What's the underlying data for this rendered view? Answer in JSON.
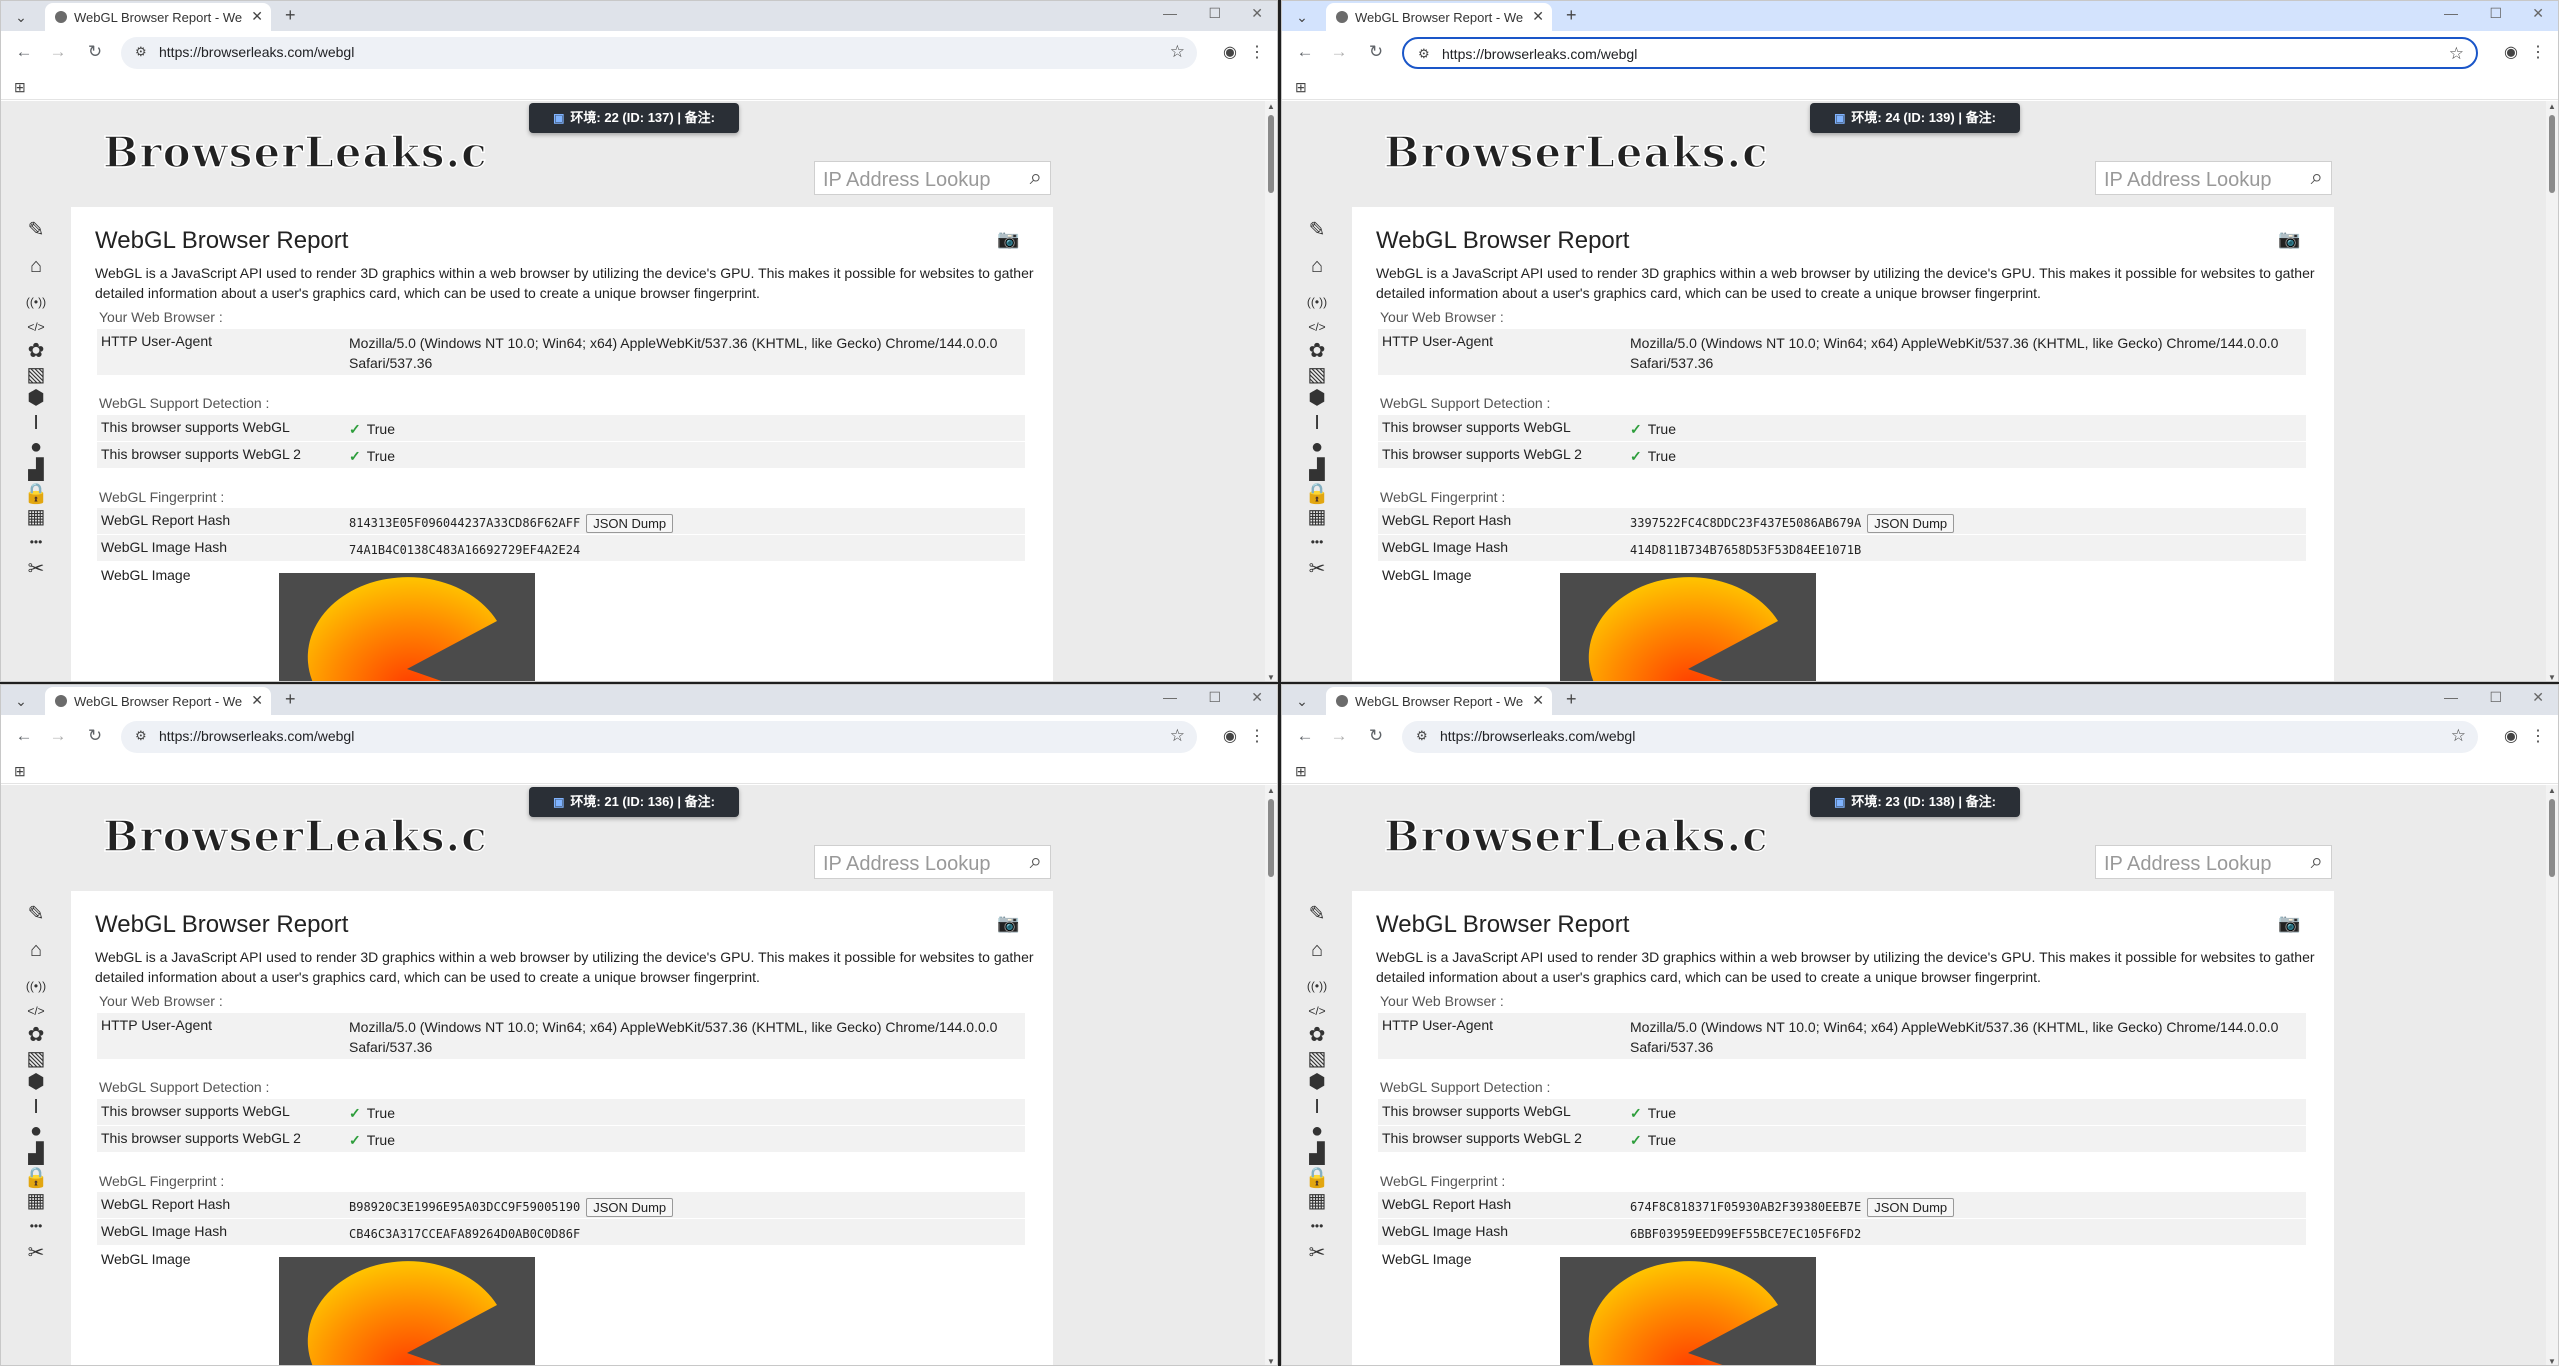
{
  "windows": [
    {
      "tab_title": "WebGL Browser Report - We",
      "url": "https://browserleaks.com/webgl",
      "env_badge": "环境: 22 (ID: 137) | 备注:",
      "report_hash": "814313E05F096044237A33CD86F62AFF",
      "image_hash": "74A1B4C0138C483A16692729EF4A2E24"
    },
    {
      "tab_title": "WebGL Browser Report - We",
      "url": "https://browserleaks.com/webgl",
      "env_badge": "环境: 24 (ID: 139) | 备注:",
      "report_hash": "3397522FC4C8DDC23F437E5086AB679A",
      "image_hash": "414D811B734B7658D53F53D84EE1071B"
    },
    {
      "tab_title": "WebGL Browser Report - We",
      "url": "https://browserleaks.com/webgl",
      "env_badge": "环境: 21 (ID: 136) | 备注:",
      "report_hash": "B98920C3E1996E95A03DCC9F59005190",
      "image_hash": "CB46C3A317CCEAFA89264D0AB0C0D86F"
    },
    {
      "tab_title": "WebGL Browser Report - We",
      "url": "https://browserleaks.com/webgl",
      "env_badge": "环境: 23 (ID: 138) | 备注:",
      "report_hash": "674F8C818371F05930AB2F39380EEB7E",
      "image_hash": "6BBF03959EED99EF55BCE7EC105F6FD2"
    }
  ],
  "page": {
    "logo_text": "BrowserLeaks.com",
    "search_placeholder": "IP Address Lookup",
    "title": "WebGL Browser Report",
    "intro": "WebGL is a JavaScript API used to render 3D graphics within a web browser by utilizing the device's GPU. This makes it possible for websites to gather detailed information about a user's graphics card, which can be used to create a unique browser fingerprint.",
    "section_browser": "Your Web Browser :",
    "ua_label": "HTTP User-Agent",
    "ua_value": "Mozilla/5.0 (Windows NT 10.0; Win64; x64) AppleWebKit/537.36 (KHTML, like Gecko) Chrome/144.0.0.0 Safari/537.36",
    "section_support": "WebGL Support Detection :",
    "webgl1_label": "This browser supports WebGL",
    "webgl2_label": "This browser supports WebGL 2",
    "true_text": "True",
    "section_fp": "WebGL Fingerprint :",
    "report_hash_label": "WebGL Report Hash",
    "image_hash_label": "WebGL Image Hash",
    "image_label": "WebGL Image",
    "json_dump": "JSON Dump"
  },
  "icons": {
    "nav": [
      "pin-icon",
      "home-icon",
      "broadcast-icon",
      "code-icon",
      "stamp-icon",
      "image-icon",
      "cube-icon",
      "text-cursor-icon",
      "location-icon",
      "chart-icon",
      "lock-icon",
      "firewall-icon",
      "more-icon",
      "tools-icon"
    ]
  },
  "colors": {
    "check": "#2e9e3c",
    "badge_bg": "#2a2f36",
    "active_tabstrip": "#d3e3fd",
    "omnibox_focus": "#1a56c8"
  },
  "active_window_index": 1
}
